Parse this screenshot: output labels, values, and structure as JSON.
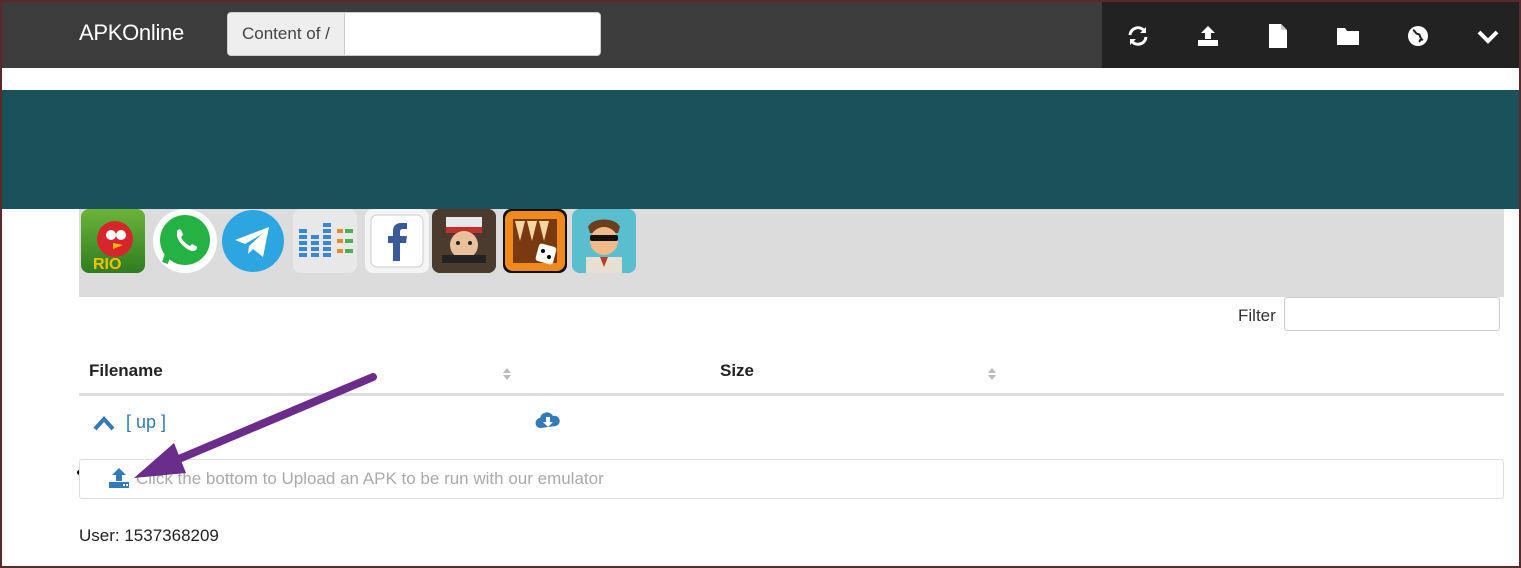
{
  "header": {
    "brand": "APKOnline",
    "path_prefix": "Content of /",
    "path_value": "",
    "toolbar": [
      "refresh-icon",
      "upload-icon",
      "file-icon",
      "folder-icon",
      "globe-icon",
      "chevron-down-icon"
    ]
  },
  "apps": [
    {
      "name": "angry-birds-rio"
    },
    {
      "name": "whatsapp"
    },
    {
      "name": "telegram"
    },
    {
      "name": "equalizer"
    },
    {
      "name": "facebook"
    },
    {
      "name": "shooter-game"
    },
    {
      "name": "backgammon"
    },
    {
      "name": "spy-game"
    }
  ],
  "filter": {
    "label": "Filter",
    "value": ""
  },
  "table": {
    "columns": [
      "Filename",
      "Size"
    ],
    "up_label": "[ up ]"
  },
  "upload": {
    "text": "Click the bottom to Upload an APK to be run with our emulator"
  },
  "user": {
    "label": "User: 1537368209"
  },
  "colors": {
    "topbar": "#3c3c3c",
    "iconbar": "#222222",
    "banner": "#1b525a",
    "link": "#337ab7",
    "arrow": "#6b2d8c"
  }
}
